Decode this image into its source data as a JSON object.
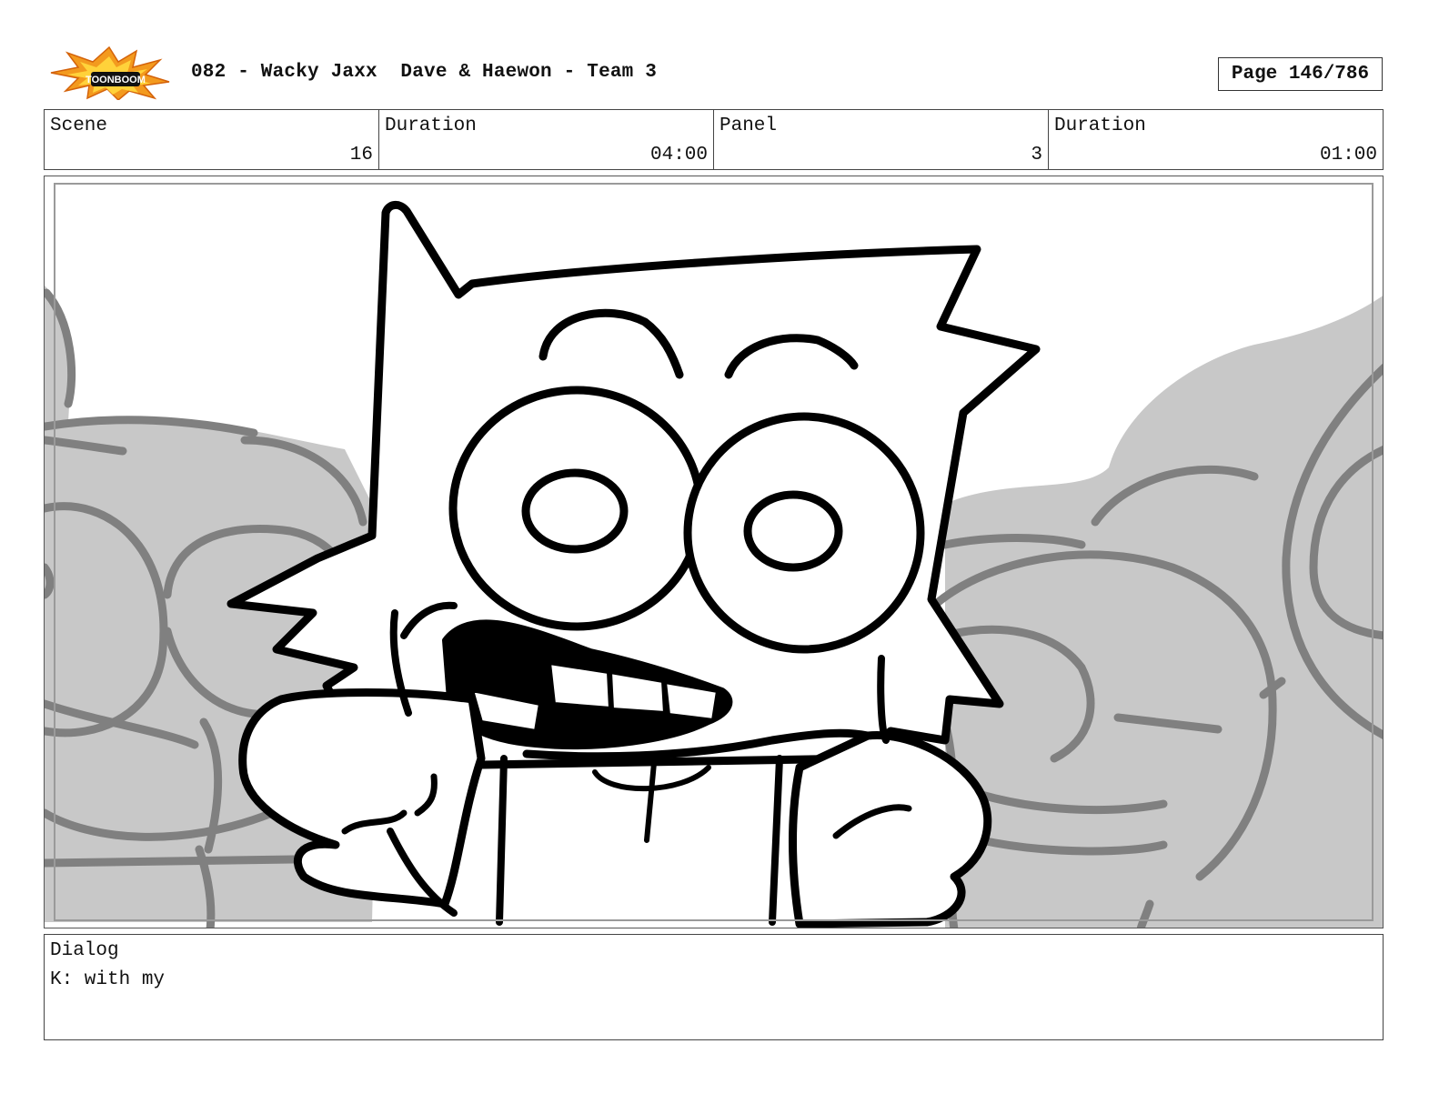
{
  "header": {
    "logo_text": "TOONBOOM",
    "title": "082 - Wacky Jaxx  Dave & Haewon - Team 3",
    "page_label": "Page 146/786"
  },
  "info": {
    "scene_label": "Scene",
    "scene_value": "16",
    "scene_duration_label": "Duration",
    "scene_duration_value": "04:00",
    "panel_label": "Panel",
    "panel_value": "3",
    "panel_duration_label": "Duration",
    "panel_duration_value": "01:00"
  },
  "dialog": {
    "label": "Dialog",
    "text": "K: with my"
  },
  "colors": {
    "logo_orange": "#f39a1e",
    "background_crowd": "#c8c8c8",
    "crowd_lines": "#808080",
    "ink": "#000000"
  }
}
